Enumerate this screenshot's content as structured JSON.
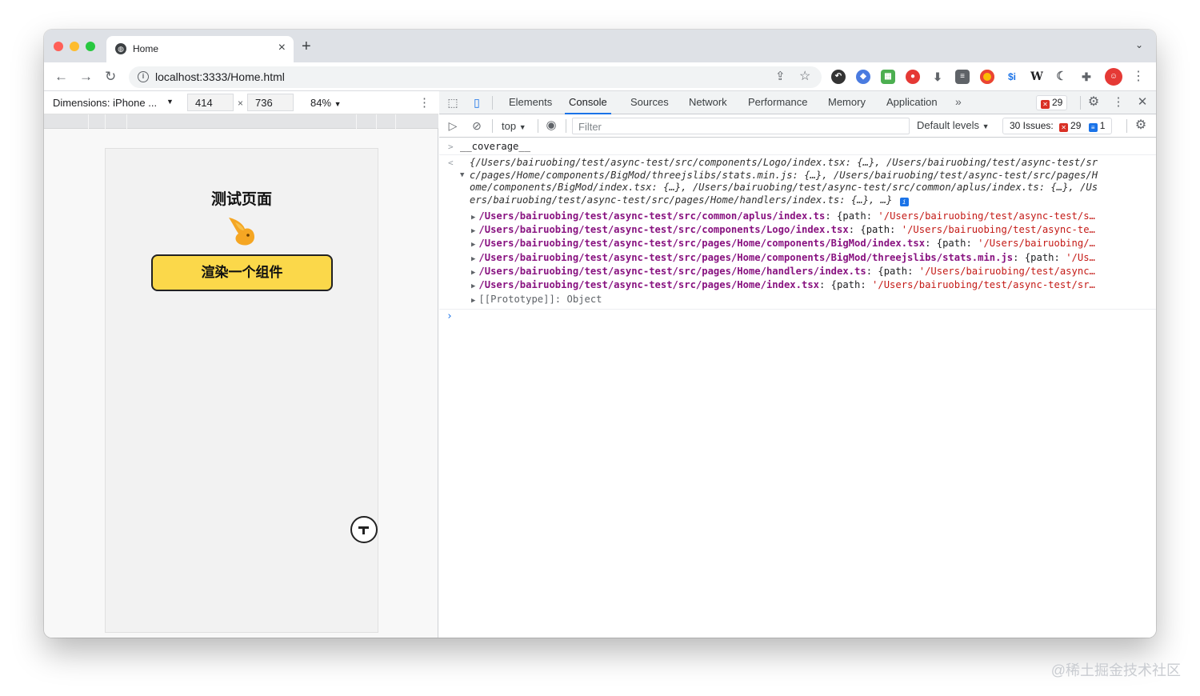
{
  "browser": {
    "tab_title": "Home",
    "tab_close": "×",
    "new_tab": "+",
    "tab_menu": "⌄",
    "url": "localhost:3333/Home.html"
  },
  "device_toolbar": {
    "dimensions_label": "Dimensions: iPhone ...",
    "caret": "▼",
    "width": "414",
    "times": "×",
    "height": "736",
    "zoom": "84%"
  },
  "page": {
    "title": "测试页面",
    "button_label": "渲染一个组件"
  },
  "devtools": {
    "tabs": [
      "Elements",
      "Console",
      "Sources",
      "Network",
      "Performance",
      "Memory",
      "Application"
    ],
    "more": "»",
    "error_count": "29",
    "context": "top",
    "filter_placeholder": "Filter",
    "levels": "Default levels",
    "issues_label": "30 Issues:",
    "issues_errors": "29",
    "issues_info": "1"
  },
  "console": {
    "command": "__coverage__",
    "summary_lines": [
      "{/Users/bairuobing/test/async-test/src/components/Logo/index.tsx: {…}, /Users/bairuobing/test/async-test/sr",
      "c/pages/Home/components/BigMod/threejslibs/stats.min.js: {…}, /Users/bairuobing/test/async-test/src/pages/H",
      "ome/components/BigMod/index.tsx: {…}, /Users/bairuobing/test/async-test/src/common/aplus/index.ts: {…}, /Us",
      "ers/bairuobing/test/async-test/src/pages/Home/handlers/index.ts: {…}, …}"
    ],
    "entries": [
      {
        "key": "/Users/bairuobing/test/async-test/src/common/aplus/index.ts",
        "rest": ": {path: ",
        "val": "'/Users/bairuobing/test/async-test/s…"
      },
      {
        "key": "/Users/bairuobing/test/async-test/src/components/Logo/index.tsx",
        "rest": ": {path: ",
        "val": "'/Users/bairuobing/test/async-te…"
      },
      {
        "key": "/Users/bairuobing/test/async-test/src/pages/Home/components/BigMod/index.tsx",
        "rest": ": {path: ",
        "val": "'/Users/bairuobing/…"
      },
      {
        "key": "/Users/bairuobing/test/async-test/src/pages/Home/components/BigMod/threejslibs/stats.min.js",
        "rest": ": {path: ",
        "val": "'/Us…"
      },
      {
        "key": "/Users/bairuobing/test/async-test/src/pages/Home/handlers/index.ts",
        "rest": ": {path: ",
        "val": "'/Users/bairuobing/test/async…"
      },
      {
        "key": "/Users/bairuobing/test/async-test/src/pages/Home/index.tsx",
        "rest": ": {path: ",
        "val": "'/Users/bairuobing/test/async-test/sr…"
      }
    ],
    "prototype": "[[Prototype]]: Object"
  },
  "watermark": "@稀土掘金技术社区",
  "colors": {
    "accent": "#1a73e8",
    "button_bg": "#fbd84a",
    "error": "#d93025",
    "prop": "#881280",
    "string": "#c41a16"
  }
}
